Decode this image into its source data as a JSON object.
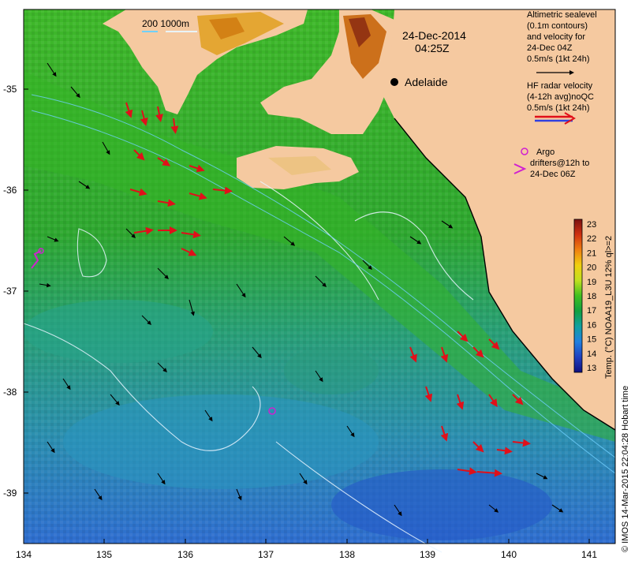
{
  "map": {
    "date": "24-Dec-2014",
    "time": "04:25Z",
    "city": "Adelaide",
    "depth_contours": "200  1000m",
    "colors": {
      "land": "#f5c9a0",
      "sea_warm": "#2fb81a",
      "sea_cool": "#2a9a8a",
      "sea_cold": "#3a7ad8",
      "hf_radar": "#e0101a",
      "argo": "#d020d0"
    },
    "lat_ticks": [
      "-35",
      "-36",
      "-37",
      "-38",
      "-39"
    ],
    "lon_ticks": [
      "134",
      "135",
      "136",
      "137",
      "138",
      "139",
      "140",
      "141"
    ]
  },
  "legend": {
    "altimetric": [
      "Altimetric sealevel",
      "(0.1m contours)",
      "and velocity for",
      "24-Dec 04Z",
      "0.5m/s (1kt 24h)"
    ],
    "hf_radar": [
      "HF radar velocity",
      "(4-12h avg)noQC",
      "0.5m/s (1kt 24h)"
    ],
    "argo": [
      "Argo",
      "drifters@12h to",
      "24-Dec 06Z"
    ]
  },
  "colorbar": {
    "ticks": [
      "23",
      "22",
      "21",
      "20",
      "19",
      "18",
      "17",
      "16",
      "15",
      "14",
      "13"
    ],
    "label": "Temp. (°C) NOAA19_L3U 12% ql>=2"
  },
  "credit": "© IMOS 14-Mar-2015 22:04:28 Hobart time"
}
